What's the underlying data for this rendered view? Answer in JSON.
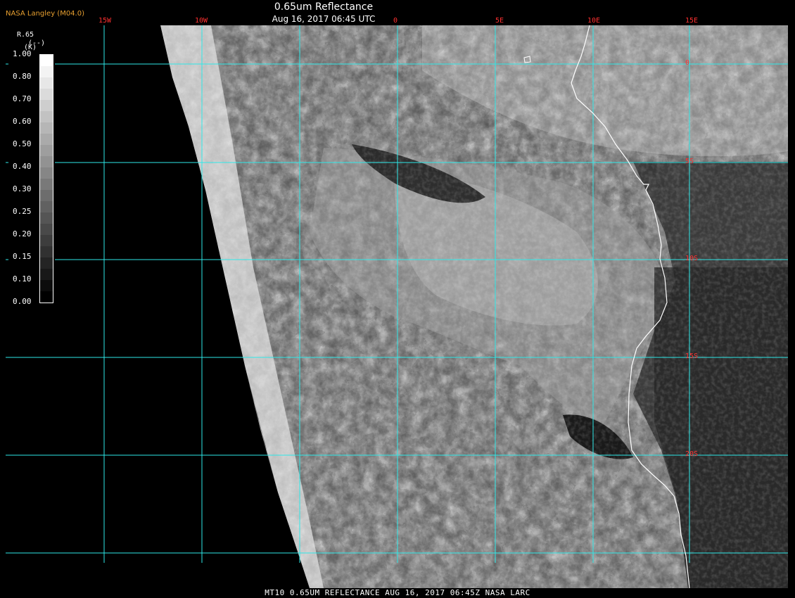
{
  "header": {
    "producer": "NASA Langley (M04.0)",
    "title": "0.65um Reflectance",
    "subtitle": "Aug 16, 2017 06:45 UTC"
  },
  "longitude_labels": [
    "15W",
    "10W",
    "0",
    "5E",
    "10E",
    "15E"
  ],
  "latitude_labels": [
    "0",
    "5S",
    "10S",
    "15S",
    "20S"
  ],
  "legend": {
    "title": "R.65",
    "units": "(--)",
    "mark": "(K)",
    "ticks": [
      "1.00",
      "0.80",
      "0.70",
      "0.60",
      "0.50",
      "0.40",
      "0.30",
      "0.25",
      "0.20",
      "0.15",
      "0.10",
      "0.00"
    ]
  },
  "footer": "MT10  0.65UM REFLECTANCE   AUG 16, 2017 06:45Z   NASA LARC",
  "colors": {
    "grid": "#2ee8e8",
    "grid_label": "#ff3030",
    "coastline": "#ffffff",
    "producer": "#e8a030",
    "background": "#000000"
  }
}
